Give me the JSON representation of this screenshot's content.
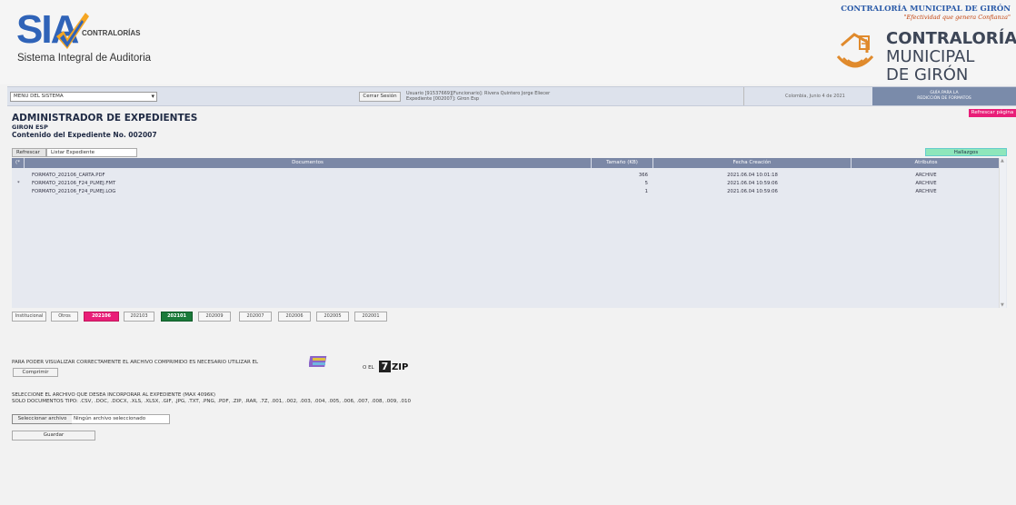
{
  "header": {
    "sia_logo": "SIA",
    "sia_brand": "CONTRALORÍAS",
    "sia_subtitle": "Sistema Integral de Auditoria",
    "contraloria_top": "CONTRALORÍA MUNICIPAL DE GIRÓN",
    "contraloria_slogan": "\"Efectividad que genera Confianza\"",
    "contraloria_name_l1": "CONTRALORÍA",
    "contraloria_name_l2": "MUNICIPAL",
    "contraloria_name_l3": "DE GIRÓN"
  },
  "topbar": {
    "menu_value": "MENU DEL SISTEMA",
    "cerrar_label": "Cerrar Sesión",
    "user_line1": "Usuario [91537669][Funcionario]: Rivera Quintero Jorge Eliecer",
    "user_line2": "Expediente [002007]: Giron Esp",
    "fecha": "Colombia, Junio 4 de 2021",
    "guia_l1": "GUÍA PARA LA",
    "guia_l2": "REDICCIÓN DE FORMATOS"
  },
  "refrescar_pagina": "Refrescar página",
  "title": {
    "main": "ADMINISTRADOR DE EXPEDIENTES",
    "entity": "GIRON ESP",
    "contenido": "Contenido del Expediente No. 002007"
  },
  "tabs": {
    "refrescar": "Refrescar",
    "listar": "Listar Expediente"
  },
  "hallazgos": "Hallazgos",
  "grid": {
    "columns": [
      "(*",
      "Documentos",
      "Tamaño (KB)",
      "Fecha Creación",
      "Atributos"
    ],
    "rows": [
      {
        "mark": "",
        "doc": "FORMATO_202106_CARTA.PDF",
        "size": "366",
        "date": "2021.06.04 10:01:18",
        "attr": "ARCHIVE"
      },
      {
        "mark": "*",
        "doc": "FORMATO_202106_F24_PLMEJ.FMT",
        "size": "5",
        "date": "2021.06.04 10:59:06",
        "attr": "ARCHIVE"
      },
      {
        "mark": "",
        "doc": "FORMATO_202106_F24_PLMEJ.LOG",
        "size": "1",
        "date": "2021.06.04 10:59:06",
        "attr": "ARCHIVE"
      }
    ]
  },
  "period_tabs": [
    {
      "label": "Institucional"
    },
    {
      "label": "Otros"
    },
    {
      "label": "202106",
      "bg": "#e91e78"
    },
    {
      "label": "202103"
    },
    {
      "label": "202101",
      "bg": "#1b7a3a"
    },
    {
      "label": "202009"
    },
    {
      "label": "202007"
    },
    {
      "label": "202006"
    },
    {
      "label": "202005"
    },
    {
      "label": "202001"
    }
  ],
  "compress_msg": "PARA PODER VISUALIZAR CORRECTAMENTE EL ARCHIVO COMPRIMIDO ES NECESARIO UTILIZAR EL",
  "compress_or": "O EL",
  "zip_label": "ZIP",
  "zip_digit": "7",
  "comprimir_label": "Comprimir",
  "select_msg1": "SELECCIONE EL ARCHIVO QUE DESEA INCORPORAR AL EXPEDIENTE (MAX 4096K)",
  "select_msg2": "SOLO DOCUMENTOS TIPO: .CSV, .DOC, .DOCX, .XLS, .XLSX, .GIF, .JPG, .TXT, .PNG, .PDF, .ZIP, .RAR, .7Z, .001, .002, .003, .004, .005, .006, .007, .008, .009, .010",
  "file_button": "Seleccionar archivo",
  "file_none": "Ningún archivo seleccionado",
  "guardar_label": "Guardar"
}
